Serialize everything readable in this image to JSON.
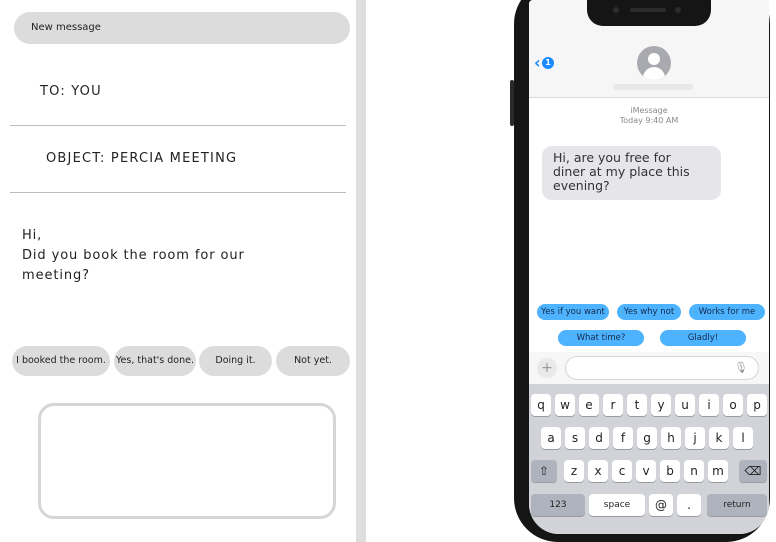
{
  "email": {
    "header": "New message",
    "to": "TO: YOU",
    "object": "OBJECT: PERCIA MEETING",
    "body_lines": [
      "Hi,",
      " Did you book the room for our",
      "meeting?"
    ],
    "quick_replies": [
      "I booked the room.",
      "Yes, that's done.",
      "Doing it.",
      "Not yet."
    ]
  },
  "phone": {
    "back_badge": "1",
    "service": "iMessage",
    "timestamp": "Today 9:40 AM",
    "incoming_lines": [
      "Hi, are you free for",
      "diner at my place this",
      "evening?"
    ],
    "suggestions": [
      "Yes if you want",
      "Yes why not",
      "Works for me",
      "What time?",
      "Gladly!"
    ],
    "plus_glyph": "+",
    "keyboard": {
      "row1": [
        "q",
        "w",
        "e",
        "r",
        "t",
        "y",
        "u",
        "i",
        "o",
        "p"
      ],
      "row2": [
        "a",
        "s",
        "d",
        "f",
        "g",
        "h",
        "j",
        "k",
        "l"
      ],
      "row3": [
        "z",
        "x",
        "c",
        "v",
        "b",
        "n",
        "m"
      ],
      "shift_glyph": "⇧",
      "delete_glyph": "⌫",
      "numbers": "123",
      "space": "space",
      "at": "@",
      "period": ".",
      "return": "return"
    },
    "colors": {
      "accent_blue": "#1a8cff",
      "suggestion_blue": "#4db3ff",
      "bubble_gray": "#e5e5ea",
      "keyboard_bg": "#d1d3d9"
    }
  }
}
